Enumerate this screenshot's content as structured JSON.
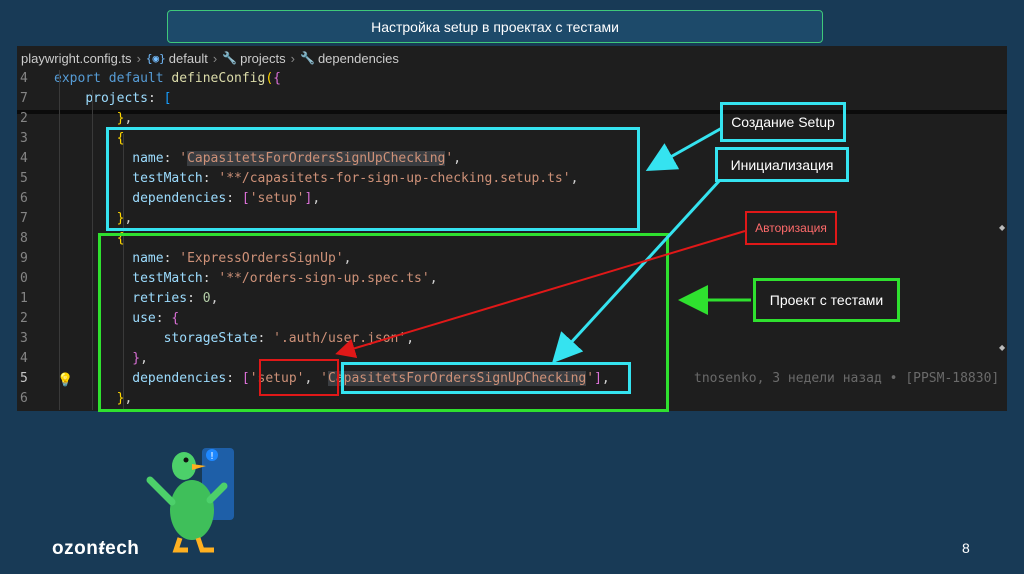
{
  "slide": {
    "title": "Настройка setup в проектах с тестами",
    "page_number": "8",
    "logo_text": "ozon tech"
  },
  "editor": {
    "breadcrumb": {
      "file": "playwright.config.ts",
      "symbol_icon": "symbol-object-icon",
      "default": "default",
      "projects": "projects",
      "dependencies": "dependencies"
    },
    "sticky_lines": [
      {
        "num": "4",
        "parts": [
          {
            "t": "export default ",
            "c": "kw"
          },
          {
            "t": "defineConfig",
            "c": "fn"
          },
          {
            "t": "(",
            "c": "b1"
          },
          {
            "t": "{",
            "c": "b2"
          }
        ]
      },
      {
        "num": "7",
        "parts": [
          {
            "t": "    "
          },
          {
            "t": "projects",
            "c": "prop"
          },
          {
            "t": ": "
          },
          {
            "t": "[",
            "c": "b3"
          }
        ]
      }
    ],
    "lines": [
      {
        "num": "2",
        "parts": [
          {
            "t": "        "
          },
          {
            "t": "}",
            "c": "b1"
          },
          {
            "t": ","
          }
        ]
      },
      {
        "num": "3",
        "parts": [
          {
            "t": "        "
          },
          {
            "t": "{",
            "c": "b1"
          }
        ]
      },
      {
        "num": "4",
        "parts": [
          {
            "t": "          "
          },
          {
            "t": "name",
            "c": "prop"
          },
          {
            "t": ": "
          },
          {
            "t": "'",
            "c": "str"
          },
          {
            "t": "CapasitetsForOrdersSignUpChecking",
            "c": "str hl"
          },
          {
            "t": "'",
            "c": "str"
          },
          {
            "t": ","
          }
        ]
      },
      {
        "num": "5",
        "parts": [
          {
            "t": "          "
          },
          {
            "t": "testMatch",
            "c": "prop"
          },
          {
            "t": ": "
          },
          {
            "t": "'**/capasitets-for-sign-up-checking.setup.ts'",
            "c": "str"
          },
          {
            "t": ","
          }
        ]
      },
      {
        "num": "6",
        "parts": [
          {
            "t": "          "
          },
          {
            "t": "dependencies",
            "c": "prop"
          },
          {
            "t": ": "
          },
          {
            "t": "[",
            "c": "b2"
          },
          {
            "t": "'setup'",
            "c": "str"
          },
          {
            "t": "]",
            "c": "b2"
          },
          {
            "t": ","
          }
        ]
      },
      {
        "num": "7",
        "parts": [
          {
            "t": "        "
          },
          {
            "t": "}",
            "c": "b1"
          },
          {
            "t": ","
          }
        ]
      },
      {
        "num": "8",
        "parts": [
          {
            "t": "        "
          },
          {
            "t": "{",
            "c": "b1"
          }
        ]
      },
      {
        "num": "9",
        "parts": [
          {
            "t": "          "
          },
          {
            "t": "name",
            "c": "prop"
          },
          {
            "t": ": "
          },
          {
            "t": "'ExpressOrdersSignUp'",
            "c": "str"
          },
          {
            "t": ","
          }
        ]
      },
      {
        "num": "0",
        "parts": [
          {
            "t": "          "
          },
          {
            "t": "testMatch",
            "c": "prop"
          },
          {
            "t": ": "
          },
          {
            "t": "'**/orders-sign-up.spec.ts'",
            "c": "str"
          },
          {
            "t": ","
          }
        ]
      },
      {
        "num": "1",
        "parts": [
          {
            "t": "          "
          },
          {
            "t": "retries",
            "c": "prop"
          },
          {
            "t": ": "
          },
          {
            "t": "0",
            "c": "num"
          },
          {
            "t": ","
          }
        ]
      },
      {
        "num": "2",
        "parts": [
          {
            "t": "          "
          },
          {
            "t": "use",
            "c": "prop"
          },
          {
            "t": ": "
          },
          {
            "t": "{",
            "c": "b2"
          }
        ]
      },
      {
        "num": "3",
        "parts": [
          {
            "t": "              "
          },
          {
            "t": "storageState",
            "c": "prop"
          },
          {
            "t": ": "
          },
          {
            "t": "'.auth/user.json'",
            "c": "str"
          },
          {
            "t": ","
          }
        ]
      },
      {
        "num": "4",
        "parts": [
          {
            "t": "          "
          },
          {
            "t": "}",
            "c": "b2"
          },
          {
            "t": ","
          }
        ]
      },
      {
        "num": "5",
        "active": true,
        "bulb": true,
        "parts": [
          {
            "t": "          "
          },
          {
            "t": "dependencies",
            "c": "prop"
          },
          {
            "t": ": "
          },
          {
            "t": "[",
            "c": "b2"
          },
          {
            "t": "'setup'",
            "c": "str"
          },
          {
            "t": ", "
          },
          {
            "t": "'",
            "c": "str"
          },
          {
            "t": "CapasitetsForOrdersSignUpChecking",
            "c": "str hl"
          },
          {
            "t": "'",
            "c": "str"
          },
          {
            "t": "]",
            "c": "b2"
          },
          {
            "t": ","
          }
        ],
        "blame": "tnosenko, 3 недели назад • [PPSM-18830]"
      },
      {
        "num": "6",
        "parts": [
          {
            "t": "        "
          },
          {
            "t": "}",
            "c": "b1"
          },
          {
            "t": ","
          }
        ]
      }
    ]
  },
  "annotations": {
    "setup_creation": "Создание Setup",
    "initialization": "Инициализация",
    "authorization": "Авторизация",
    "test_project": "Проект с тестами"
  },
  "colors": {
    "cyan": "#35e3f0",
    "green": "#2fe02f",
    "red": "#e01818",
    "slide_bg": "#183a56",
    "editor_bg": "#1e1e1e"
  }
}
